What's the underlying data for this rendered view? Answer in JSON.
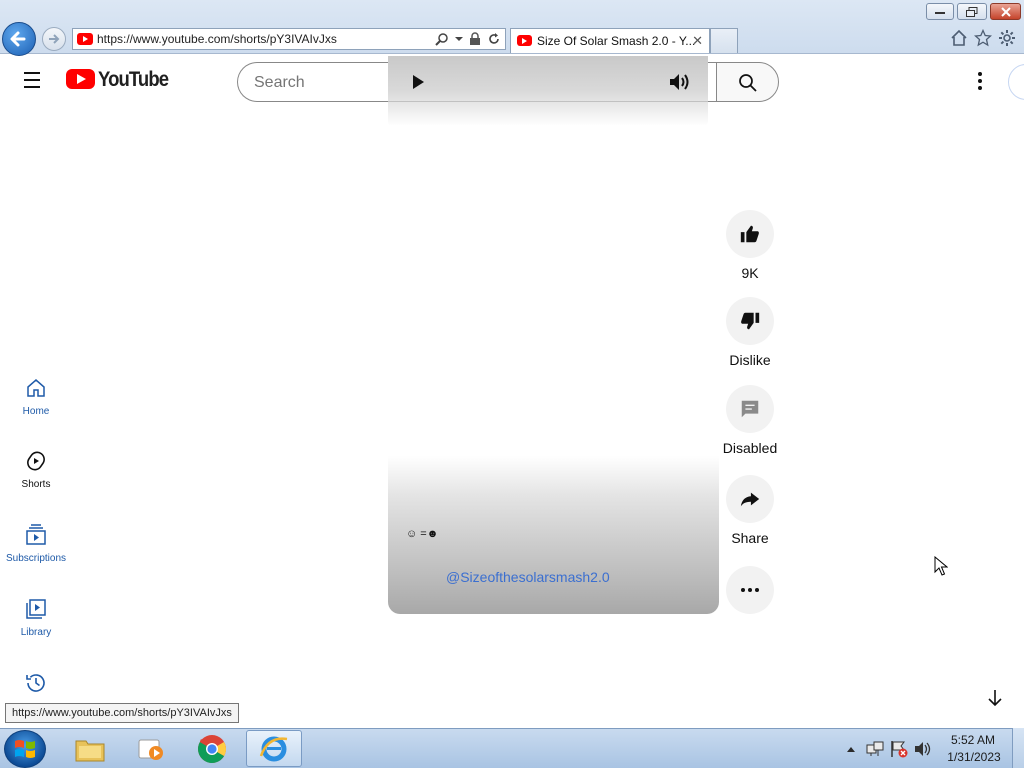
{
  "browser": {
    "address_url": "https://www.youtube.com/shorts/pY3IVAIvJxs",
    "tab_title": "Size Of Solar Smash 2.0 - Y...",
    "tab_close": "✕",
    "status_url": "https://www.youtube.com/shorts/pY3IVAIvJxs"
  },
  "youtube": {
    "logo_text": "YouTube",
    "search_placeholder": "Search"
  },
  "nav": {
    "items": [
      {
        "label": "Home",
        "icon": "home-icon"
      },
      {
        "label": "Shorts",
        "icon": "shorts-icon"
      },
      {
        "label": "Subscriptions",
        "icon": "subscriptions-icon"
      },
      {
        "label": "Library",
        "icon": "library-icon"
      },
      {
        "label": "",
        "icon": "history-icon"
      }
    ]
  },
  "short": {
    "caption": "☺ =☻",
    "channel": "@Sizeofthesolarsmash2.0",
    "actions": {
      "like_count": "9K",
      "dislike_label": "Dislike",
      "comments_label": "Disabled",
      "share_label": "Share"
    }
  },
  "taskbar": {
    "time": "5:52 AM",
    "date": "1/31/2023"
  },
  "colors": {
    "yt_red": "#ff0000",
    "link_blue": "#3b6fd0",
    "taskbar": "#b6cde8"
  }
}
